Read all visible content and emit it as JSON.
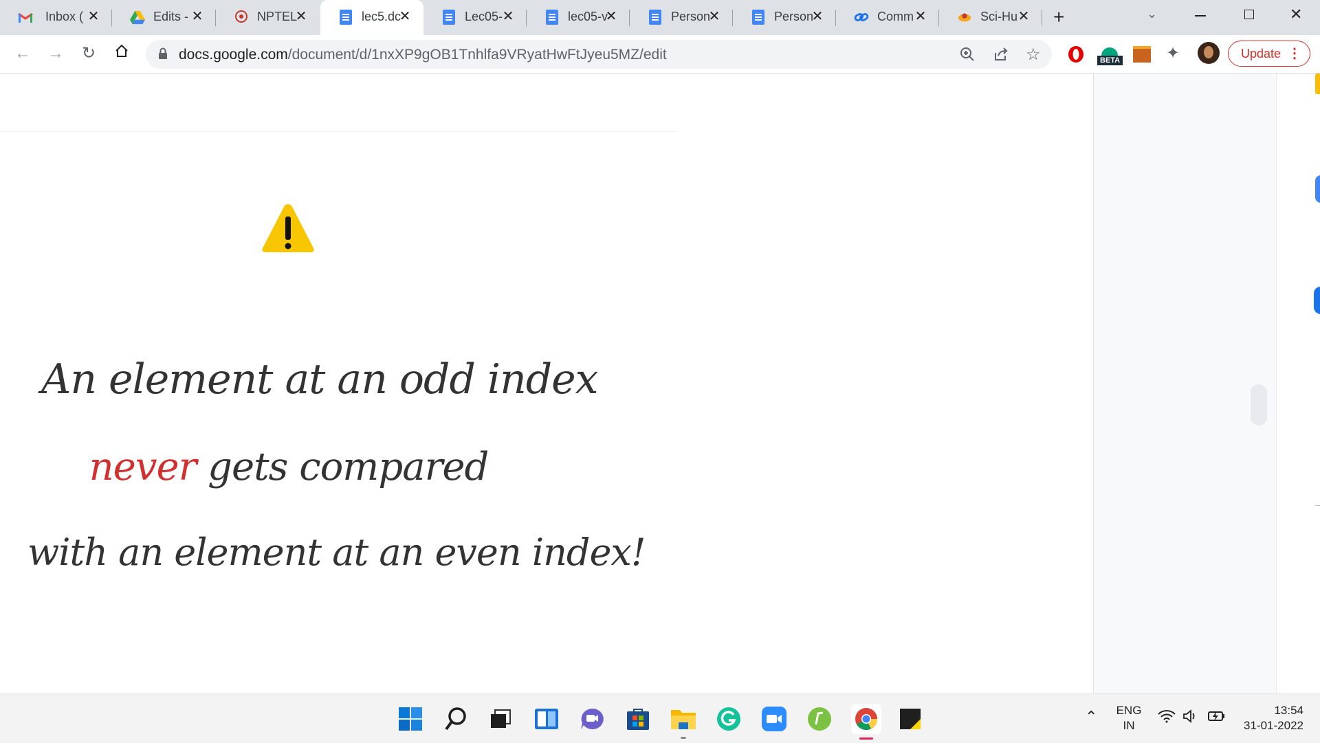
{
  "tabs": [
    {
      "title": "Inbox (",
      "icon": "gmail-icon"
    },
    {
      "title": "Edits -",
      "icon": "google-drive-icon"
    },
    {
      "title": "NPTEL",
      "icon": "nptel-icon"
    },
    {
      "title": "lec5.dc",
      "icon": "google-docs-icon",
      "active": true
    },
    {
      "title": "Lec05-",
      "icon": "google-docs-icon"
    },
    {
      "title": "lec05-v",
      "icon": "google-docs-icon"
    },
    {
      "title": "Person",
      "icon": "google-docs-icon"
    },
    {
      "title": "Person",
      "icon": "google-docs-icon"
    },
    {
      "title": "Comm",
      "icon": "link-icon"
    },
    {
      "title": "Sci-Hu",
      "icon": "sci-hub-icon"
    }
  ],
  "address_bar": {
    "domain": "docs.google.com",
    "path": "/document/d/1nxXP9gOB1Tnhlfa9VRyatHwFtJyeu5MZ/edit"
  },
  "extensions": {
    "beta_label": "BETA",
    "update_label": "Update"
  },
  "document": {
    "warning_icon": "warning-icon",
    "line1": "An element at an odd index",
    "line2_highlight": "never",
    "line2_rest": " gets compared",
    "line3": "with an element at an even index!",
    "highlight_color": "#d32f2f"
  },
  "taskbar": {
    "apps": [
      "start-icon",
      "search-icon",
      "task-view-icon",
      "widgets-icon",
      "teams-chat-icon",
      "store-icon",
      "file-explorer-icon",
      "grammarly-icon",
      "zoom-icon",
      "sheets-tool-icon",
      "chrome-icon",
      "sticky-notes-icon"
    ],
    "language_top": "ENG",
    "language_bottom": "IN",
    "time": "13:54",
    "date": "31-01-2022"
  }
}
